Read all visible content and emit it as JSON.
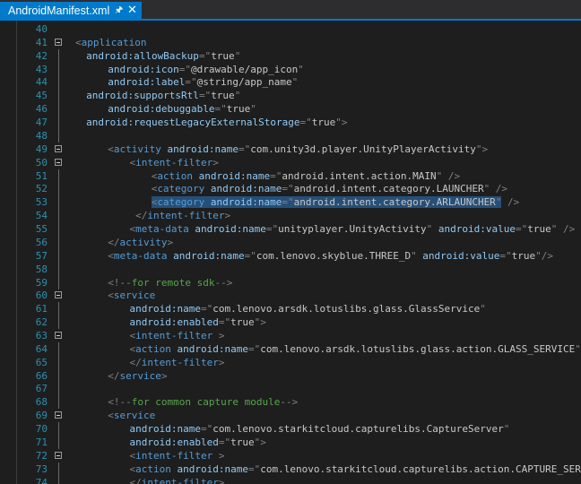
{
  "tab": {
    "title": "AndroidManifest.xml",
    "pin_icon": "pin-icon",
    "close_icon": "close-icon"
  },
  "colors": {
    "accent": "#007acc",
    "line_number": "#2b91af",
    "tag": "#569cd6",
    "attribute": "#92caf4",
    "value": "#c8c8c8",
    "comment": "#57a64a",
    "selection": "#264f78"
  },
  "lines": [
    {
      "n": "40",
      "indent": 0,
      "tokens": []
    },
    {
      "n": "41",
      "indent": 0,
      "fold": true,
      "tokens": [
        [
          "p",
          "<"
        ],
        [
          "t",
          "application"
        ]
      ]
    },
    {
      "n": "42",
      "indent": 1,
      "tokens": [
        [
          "a",
          "android:allowBackup"
        ],
        [
          "p",
          "=\""
        ],
        [
          "v",
          "true"
        ],
        [
          "p",
          "\""
        ]
      ]
    },
    {
      "n": "43",
      "indent": 3,
      "tokens": [
        [
          "a",
          "android:icon"
        ],
        [
          "p",
          "=\""
        ],
        [
          "v",
          "@drawable/app_icon"
        ],
        [
          "p",
          "\""
        ]
      ]
    },
    {
      "n": "44",
      "indent": 3,
      "tokens": [
        [
          "a",
          "android:label"
        ],
        [
          "p",
          "=\""
        ],
        [
          "v",
          "@string/app_name"
        ],
        [
          "p",
          "\""
        ]
      ]
    },
    {
      "n": "45",
      "indent": 1,
      "tokens": [
        [
          "a",
          "android:supportsRtl"
        ],
        [
          "p",
          "=\""
        ],
        [
          "v",
          "true"
        ],
        [
          "p",
          "\""
        ]
      ]
    },
    {
      "n": "46",
      "indent": 3,
      "tokens": [
        [
          "a",
          "android:debuggable"
        ],
        [
          "p",
          "=\""
        ],
        [
          "v",
          "true"
        ],
        [
          "p",
          "\""
        ]
      ]
    },
    {
      "n": "47",
      "indent": 1,
      "tokens": [
        [
          "a",
          "android:requestLegacyExternalStorage"
        ],
        [
          "p",
          "=\""
        ],
        [
          "v",
          "true"
        ],
        [
          "p",
          "\">"
        ]
      ]
    },
    {
      "n": "48",
      "indent": 0,
      "tokens": []
    },
    {
      "n": "49",
      "indent": 3,
      "fold": true,
      "tokens": [
        [
          "p",
          "<"
        ],
        [
          "t",
          "activity"
        ],
        [
          "a",
          " android:name"
        ],
        [
          "p",
          "=\""
        ],
        [
          "v",
          "com.unity3d.player.UnityPlayerActivity"
        ],
        [
          "p",
          "\">"
        ]
      ]
    },
    {
      "n": "50",
      "indent": 5,
      "fold": true,
      "tokens": [
        [
          "p",
          "<"
        ],
        [
          "t",
          "intent-filter"
        ],
        [
          "p",
          ">"
        ]
      ]
    },
    {
      "n": "51",
      "indent": 7,
      "tokens": [
        [
          "p",
          "<"
        ],
        [
          "t",
          "action"
        ],
        [
          "a",
          " android:name"
        ],
        [
          "p",
          "=\""
        ],
        [
          "v",
          "android.intent.action.MAIN"
        ],
        [
          "p",
          "\" />"
        ]
      ]
    },
    {
      "n": "52",
      "indent": 7,
      "tokens": [
        [
          "p",
          "<"
        ],
        [
          "t",
          "category"
        ],
        [
          "a",
          " android:name"
        ],
        [
          "p",
          "=\""
        ],
        [
          "v",
          "android.intent.category.LAUNCHER"
        ],
        [
          "p",
          "\" />"
        ]
      ]
    },
    {
      "n": "53",
      "indent": 7,
      "hl": true,
      "tokens": [
        [
          "p",
          "<"
        ],
        [
          "t",
          "category"
        ],
        [
          "a",
          " android:name"
        ],
        [
          "p",
          "=\""
        ],
        [
          "v",
          "android.intent.category.ARLAUNCHER"
        ],
        [
          "p",
          "\""
        ]
      ],
      "tail": [
        [
          "p",
          " />"
        ]
      ]
    },
    {
      "n": "54",
      "indent": 5,
      "tokens": [
        [
          "p",
          " </"
        ],
        [
          "t",
          "intent-filter"
        ],
        [
          "p",
          ">"
        ]
      ]
    },
    {
      "n": "55",
      "indent": 5,
      "tokens": [
        [
          "p",
          "<"
        ],
        [
          "t",
          "meta-data"
        ],
        [
          "a",
          " android:name"
        ],
        [
          "p",
          "=\""
        ],
        [
          "v",
          "unityplayer.UnityActivity"
        ],
        [
          "p",
          "\""
        ],
        [
          "a",
          " android:value"
        ],
        [
          "p",
          "=\""
        ],
        [
          "v",
          "true"
        ],
        [
          "p",
          "\" />"
        ]
      ]
    },
    {
      "n": "56",
      "indent": 3,
      "tokens": [
        [
          "p",
          "</"
        ],
        [
          "t",
          "activity"
        ],
        [
          "p",
          ">"
        ]
      ]
    },
    {
      "n": "57",
      "indent": 3,
      "tokens": [
        [
          "p",
          "<"
        ],
        [
          "t",
          "meta-data"
        ],
        [
          "a",
          " android:name"
        ],
        [
          "p",
          "=\""
        ],
        [
          "v",
          "com.lenovo.skyblue.THREE_D"
        ],
        [
          "p",
          "\""
        ],
        [
          "a",
          " android:value"
        ],
        [
          "p",
          "=\""
        ],
        [
          "v",
          "true"
        ],
        [
          "p",
          "\"/>"
        ]
      ]
    },
    {
      "n": "58",
      "indent": 0,
      "tokens": []
    },
    {
      "n": "59",
      "indent": 3,
      "tokens": [
        [
          "p",
          "<!--"
        ],
        [
          "c",
          "for remote sdk"
        ],
        [
          "p",
          "-->"
        ]
      ]
    },
    {
      "n": "60",
      "indent": 3,
      "fold": true,
      "tokens": [
        [
          "p",
          "<"
        ],
        [
          "t",
          "service"
        ]
      ]
    },
    {
      "n": "61",
      "indent": 5,
      "tokens": [
        [
          "a",
          "android:name"
        ],
        [
          "p",
          "=\""
        ],
        [
          "v",
          "com.lenovo.arsdk.lotuslibs.glass.GlassService"
        ],
        [
          "p",
          "\""
        ]
      ]
    },
    {
      "n": "62",
      "indent": 5,
      "tokens": [
        [
          "a",
          "android:enabled"
        ],
        [
          "p",
          "=\""
        ],
        [
          "v",
          "true"
        ],
        [
          "p",
          "\">"
        ]
      ]
    },
    {
      "n": "63",
      "indent": 5,
      "fold": true,
      "tokens": [
        [
          "p",
          "<"
        ],
        [
          "t",
          "intent-filter"
        ],
        [
          "p",
          " >"
        ]
      ]
    },
    {
      "n": "64",
      "indent": 5,
      "tokens": [
        [
          "p",
          "<"
        ],
        [
          "t",
          "action"
        ],
        [
          "a",
          " android:name"
        ],
        [
          "p",
          "=\""
        ],
        [
          "v",
          "com.lenovo.arsdk.lotuslibs.glass.action.GLASS_SERVICE"
        ],
        [
          "p",
          "\"/>"
        ]
      ]
    },
    {
      "n": "65",
      "indent": 5,
      "tokens": [
        [
          "p",
          "</"
        ],
        [
          "t",
          "intent-filter"
        ],
        [
          "p",
          ">"
        ]
      ]
    },
    {
      "n": "66",
      "indent": 3,
      "tokens": [
        [
          "p",
          "</"
        ],
        [
          "t",
          "service"
        ],
        [
          "p",
          ">"
        ]
      ]
    },
    {
      "n": "67",
      "indent": 0,
      "tokens": []
    },
    {
      "n": "68",
      "indent": 3,
      "tokens": [
        [
          "p",
          "<!--"
        ],
        [
          "c",
          "for common capture module"
        ],
        [
          "p",
          "-->"
        ]
      ]
    },
    {
      "n": "69",
      "indent": 3,
      "fold": true,
      "tokens": [
        [
          "p",
          "<"
        ],
        [
          "t",
          "service"
        ]
      ]
    },
    {
      "n": "70",
      "indent": 5,
      "tokens": [
        [
          "a",
          "android:name"
        ],
        [
          "p",
          "=\""
        ],
        [
          "v",
          "com.lenovo.starkitcloud.capturelibs.CaptureServer"
        ],
        [
          "p",
          "\""
        ]
      ]
    },
    {
      "n": "71",
      "indent": 5,
      "tokens": [
        [
          "a",
          "android:enabled"
        ],
        [
          "p",
          "=\""
        ],
        [
          "v",
          "true"
        ],
        [
          "p",
          "\">"
        ]
      ]
    },
    {
      "n": "72",
      "indent": 5,
      "fold": true,
      "tokens": [
        [
          "p",
          "<"
        ],
        [
          "t",
          "intent-filter"
        ],
        [
          "p",
          " >"
        ]
      ]
    },
    {
      "n": "73",
      "indent": 5,
      "tokens": [
        [
          "p",
          "<"
        ],
        [
          "t",
          "action"
        ],
        [
          "a",
          " android:name"
        ],
        [
          "p",
          "=\""
        ],
        [
          "v",
          "com.lenovo.starkitcloud.capturelibs.action.CAPTURE_SERVICE"
        ],
        [
          "p",
          "\"/>"
        ]
      ]
    },
    {
      "n": "74",
      "indent": 5,
      "tokens": [
        [
          "p",
          "</"
        ],
        [
          "t",
          "intent-filter"
        ],
        [
          "p",
          ">"
        ]
      ]
    }
  ]
}
